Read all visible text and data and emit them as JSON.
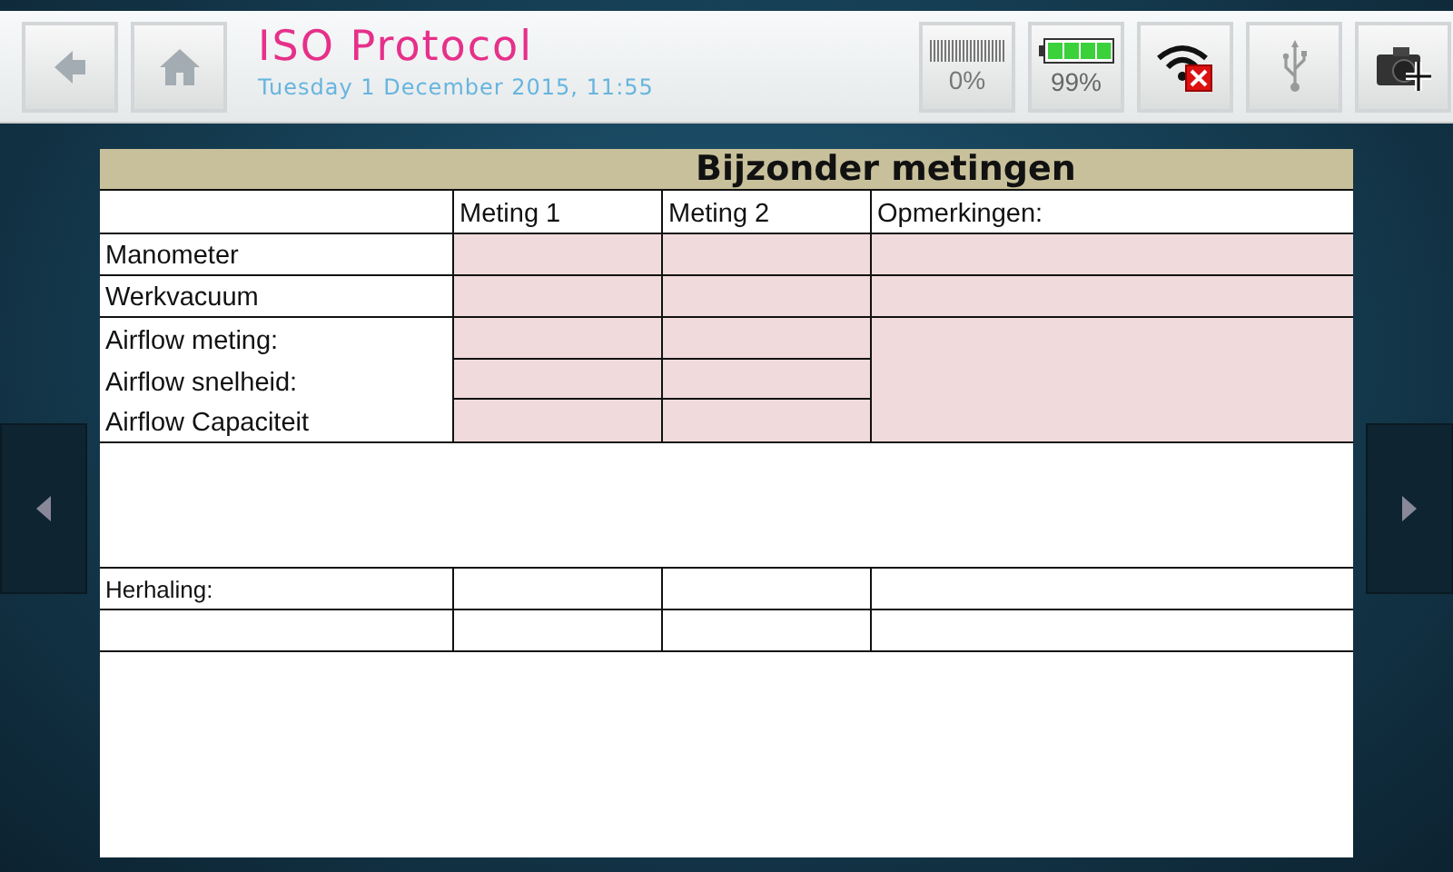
{
  "header": {
    "title": "ISO Protocol",
    "datetime": "Tuesday 1 December 2015, 11:55"
  },
  "status": {
    "storage": "0%",
    "battery": {
      "reading": "99%",
      "level": 0.99
    },
    "wifi_connected": false
  },
  "table": {
    "title": "Bijzonder metingen",
    "columns": [
      "Meting 1",
      "Meting 2",
      "Opmerkingen:"
    ],
    "rows": [
      {
        "kind": "input",
        "labels": [
          "Manometer"
        ]
      },
      {
        "kind": "input",
        "labels": [
          "Werkvacuum"
        ]
      },
      {
        "kind": "input-group",
        "labels": [
          "Airflow meting:",
          "Airflow snelheid:",
          "Airflow Capaciteit"
        ]
      },
      {
        "kind": "spacer"
      },
      {
        "kind": "plain",
        "labels": [
          "Herhaling:"
        ]
      },
      {
        "kind": "plain"
      }
    ]
  }
}
